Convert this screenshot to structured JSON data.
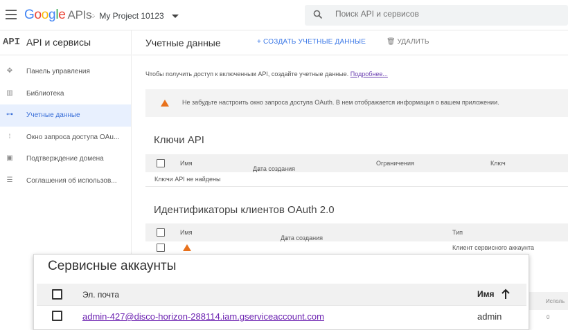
{
  "header": {
    "logo": {
      "G": "G",
      "o1": "o",
      "o2": "o",
      "g": "g",
      "l": "l",
      "e": "e",
      "apis": "APIs"
    },
    "project_name": "My Project 10123",
    "search_placeholder": "Поиск API и сервисов"
  },
  "sidebar": {
    "api_icon": "API",
    "title": "API и сервисы",
    "items": [
      {
        "label": "Панель управления",
        "icon": "dashboard-icon"
      },
      {
        "label": "Библиотека",
        "icon": "library-icon"
      },
      {
        "label": "Учетные данные",
        "icon": "key-icon",
        "active": true
      },
      {
        "label": "Окно запроса доступа OAu...",
        "icon": "consent-icon"
      },
      {
        "label": "Подтверждение домена",
        "icon": "domain-icon"
      },
      {
        "label": "Соглашения об использов...",
        "icon": "agreements-icon"
      }
    ]
  },
  "main": {
    "title": "Учетные данные",
    "create_label": "+ СОЗДАТЬ УЧЕТНЫЕ ДАННЫЕ",
    "delete_label": "УДАЛИТЬ",
    "intro_text": "Чтобы получить доступ к включенным API, создайте учетные данные. ",
    "intro_link": "Подробнее...",
    "warning_text": "Не забудьте настроить окно запроса доступа OAuth. В нем отображается информация о вашем приложении.",
    "api_keys": {
      "title": "Ключи API",
      "columns": [
        "Имя",
        "Дата создания",
        "Ограничения",
        "Ключ"
      ],
      "empty_text": "Ключи API не найдены"
    },
    "oauth": {
      "title": "Идентификаторы клиентов OAuth 2.0",
      "columns": [
        "Имя",
        "Дата создания",
        "Тип"
      ],
      "row_type": "Клиент сервисного аккаунта"
    },
    "bg_partial": {
      "col": "Исполь",
      "val": "0"
    }
  },
  "service_accounts": {
    "title": "Сервисные аккаунты",
    "columns": {
      "email": "Эл. почта",
      "name": "Имя"
    },
    "rows": [
      {
        "email": "admin-427@disco-horizon-288114.iam.gserviceaccount.com",
        "name": "admin"
      }
    ]
  },
  "colors": {
    "accent": "#3b78e7",
    "warning": "#e8711c",
    "link": "#6a1fb0",
    "active_bg": "#e8f0fe"
  }
}
